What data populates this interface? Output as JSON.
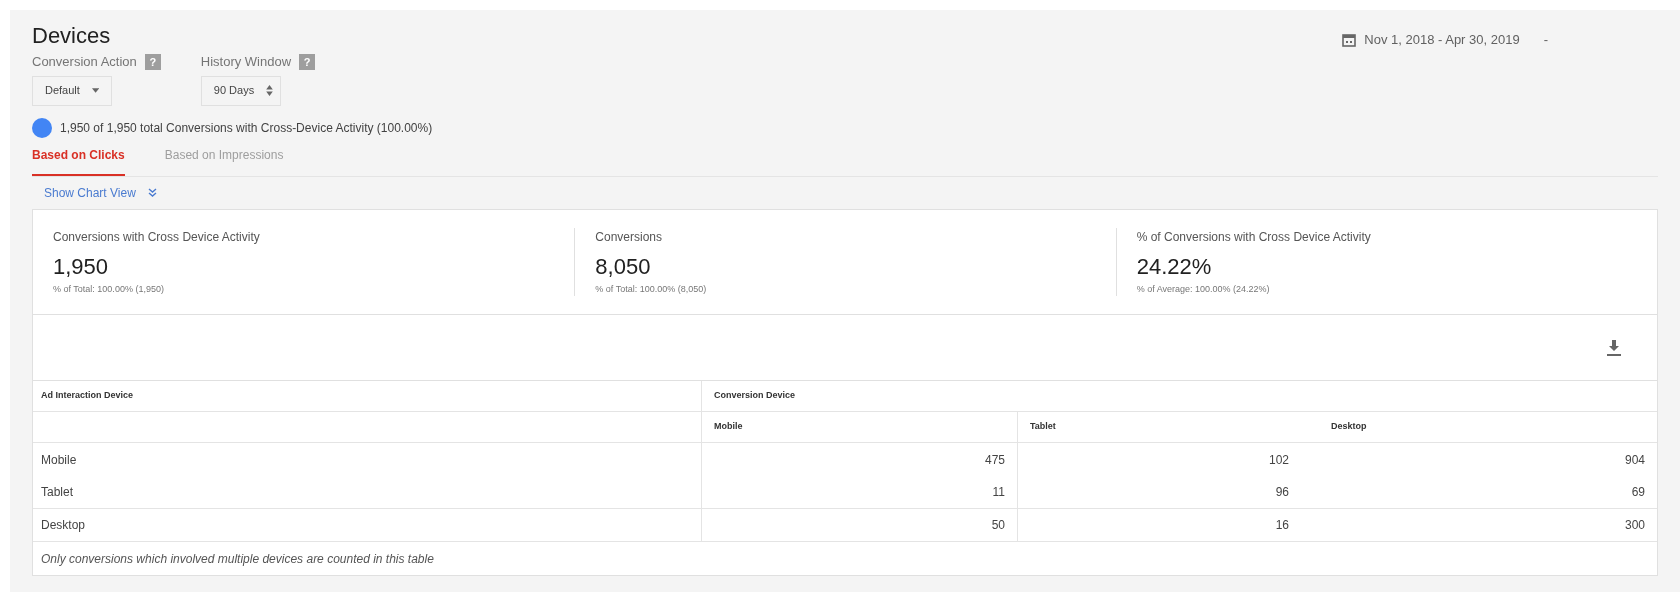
{
  "title": "Devices",
  "date_range": {
    "label": "Nov 1, 2018 - Apr 30, 2019",
    "caret": "-"
  },
  "filters": [
    {
      "label": "Conversion Action",
      "help": "?",
      "value": "Default",
      "kind": "dropdown"
    },
    {
      "label": "History Window",
      "help": "?",
      "value": "90 Days",
      "kind": "spinner"
    }
  ],
  "summary": {
    "color": "#4285f4",
    "text": "1,950 of 1,950 total Conversions with Cross-Device Activity (100.00%)"
  },
  "tabs": [
    {
      "label": "Based on Clicks",
      "selected": true
    },
    {
      "label": "Based on Impressions",
      "selected": false
    }
  ],
  "chart_toggle": "Show Chart View",
  "stats": [
    {
      "label": "Conversions with Cross Device Activity",
      "value": "1,950",
      "note": "% of Total: 100.00% (1,950)"
    },
    {
      "label": "Conversions",
      "value": "8,050",
      "note": "% of Total: 100.00% (8,050)"
    },
    {
      "label": "% of Conversions with Cross Device Activity",
      "value": "24.22%",
      "note": "% of Average: 100.00% (24.22%)"
    }
  ],
  "table": {
    "row_header": "Ad Interaction Device",
    "group_header": "Conversion Device",
    "columns": [
      "Mobile",
      "Tablet",
      "Desktop"
    ],
    "rows": [
      {
        "device": "Mobile",
        "values": [
          "475",
          "102",
          "904"
        ]
      },
      {
        "device": "Tablet",
        "values": [
          "11",
          "96",
          "69"
        ]
      },
      {
        "device": "Desktop",
        "values": [
          "50",
          "16",
          "300"
        ]
      }
    ],
    "footnote": "Only conversions which involved multiple devices are counted in this table"
  }
}
